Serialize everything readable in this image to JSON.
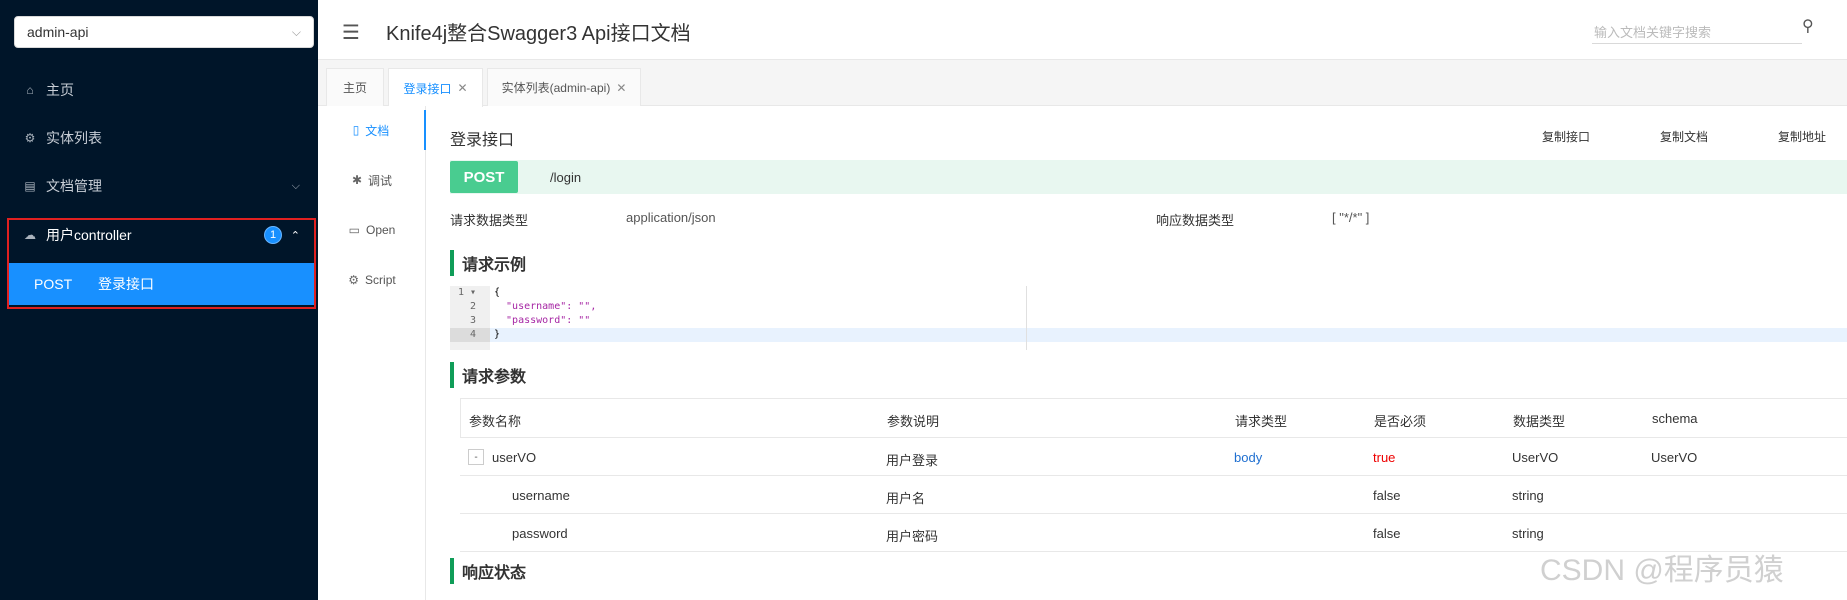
{
  "sidebar": {
    "group_select": "admin-api",
    "menu": [
      {
        "label": "主页",
        "icon": "home-icon"
      },
      {
        "label": "实体列表",
        "icon": "gear-icon"
      },
      {
        "label": "文档管理",
        "icon": "document-icon"
      }
    ],
    "group": {
      "label": "用户controller",
      "badge": "1",
      "icon": "cloud-icon"
    },
    "sub_item": {
      "method": "POST",
      "label": "登录接口"
    }
  },
  "header": {
    "title": "Knife4j整合Swagger3 Api接口文档",
    "search_placeholder": "输入文档关键字搜索"
  },
  "tabs": [
    {
      "label": "主页"
    },
    {
      "label": "登录接口"
    },
    {
      "label": "实体列表(admin-api)"
    }
  ],
  "subtabs": [
    {
      "label": "文档",
      "icon": "document-icon"
    },
    {
      "label": "调试",
      "icon": "bug-icon"
    },
    {
      "label": "Open",
      "icon": "file-icon"
    },
    {
      "label": "Script",
      "icon": "code-icon"
    }
  ],
  "doc": {
    "title": "登录接口",
    "copy_buttons": [
      "复制接口",
      "复制文档",
      "复制地址"
    ],
    "method": "POST",
    "path": "/login",
    "req_type_label": "请求数据类型",
    "req_type_value": "application/json",
    "resp_type_label": "响应数据类型",
    "resp_type_value": "[ \"*/*\" ]",
    "example_title": "请求示例",
    "example_lines": [
      "{",
      "  \"username\": \"\",",
      "  \"password\": \"\"",
      "}"
    ],
    "params_title": "请求参数",
    "params_headers": [
      "参数名称",
      "参数说明",
      "请求类型",
      "是否必须",
      "数据类型",
      "schema"
    ],
    "params_rows": [
      {
        "name": "userVO",
        "desc": "用户登录",
        "in": "body",
        "required": "true",
        "type": "UserVO",
        "schema": "UserVO"
      },
      {
        "name": "username",
        "desc": "用户名",
        "in": "",
        "required": "false",
        "type": "string",
        "schema": ""
      },
      {
        "name": "password",
        "desc": "用户密码",
        "in": "",
        "required": "false",
        "type": "string",
        "schema": ""
      }
    ],
    "response_title": "响应状态"
  },
  "watermark": "CSDN @程序员猿",
  "colors": {
    "sidebar_bg": "#001529",
    "accent": "#1890ff",
    "post": "#49cc90",
    "section_bar": "#0f9d58"
  }
}
